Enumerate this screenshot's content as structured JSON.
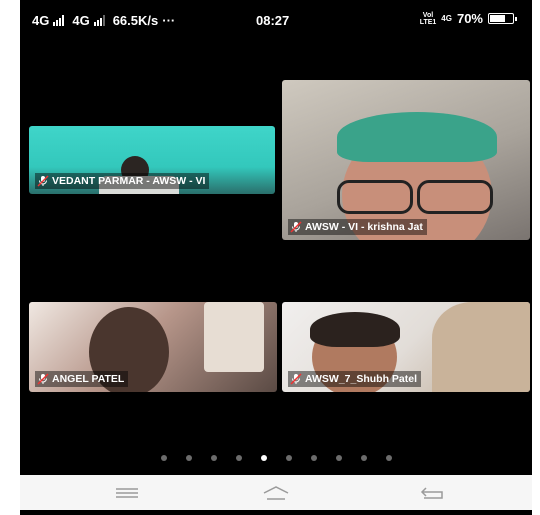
{
  "status_bar": {
    "network1": "4G",
    "network2": "4G",
    "speed": "66.5K/s",
    "more": "···",
    "time": "08:27",
    "volte_top": "Vol",
    "volte_bottom": "LTE1",
    "lte": "4G",
    "battery": "70%",
    "battery_level": 0.7
  },
  "participants": [
    {
      "name": "VEDANT PARMAR - AWSW - VI",
      "muted": true
    },
    {
      "name": "AWSW - VI -  krishna Jat",
      "muted": true
    },
    {
      "name": "ANGEL PATEL",
      "muted": true
    },
    {
      "name": "AWSW_7_Shubh Patel",
      "muted": true
    }
  ],
  "pager": {
    "count": 10,
    "active_index": 4
  },
  "nav_bar": {
    "icons": [
      "menu-icon",
      "home-icon",
      "back-icon"
    ]
  },
  "colors": {
    "background": "#000000",
    "label_text": "#ffffff",
    "nav_bg": "#f6f6f6"
  }
}
